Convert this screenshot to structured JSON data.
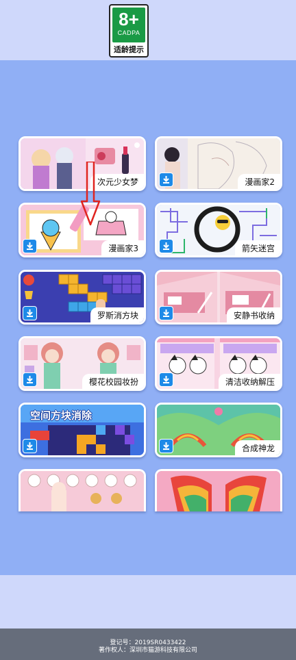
{
  "age_rating": {
    "number": "8+",
    "org": "CADPA",
    "tip": "适龄提示"
  },
  "games": [
    {
      "name": "次元少女梦",
      "download": false
    },
    {
      "name": "漫画家2",
      "download": true
    },
    {
      "name": "漫画家3",
      "download": true
    },
    {
      "name": "箭矢迷宫",
      "download": true
    },
    {
      "name": "罗斯消方块",
      "download": true
    },
    {
      "name": "安静书收纳",
      "download": true
    },
    {
      "name": "樱花校园妆扮",
      "download": true
    },
    {
      "name": "清洁收纳解压",
      "download": true
    },
    {
      "name": "空间方块消除",
      "download": true
    },
    {
      "name": "合成神龙",
      "download": true
    },
    {
      "name": "",
      "download": false
    },
    {
      "name": "",
      "download": false
    }
  ],
  "footer": {
    "registration": "登记号：2019SR0433422",
    "copyright": "著作权人：深圳市猫游科技有限公司"
  },
  "colors": {
    "background": "#90aff5",
    "accent": "#1e8ae8",
    "badge_green": "#1a9a45"
  }
}
